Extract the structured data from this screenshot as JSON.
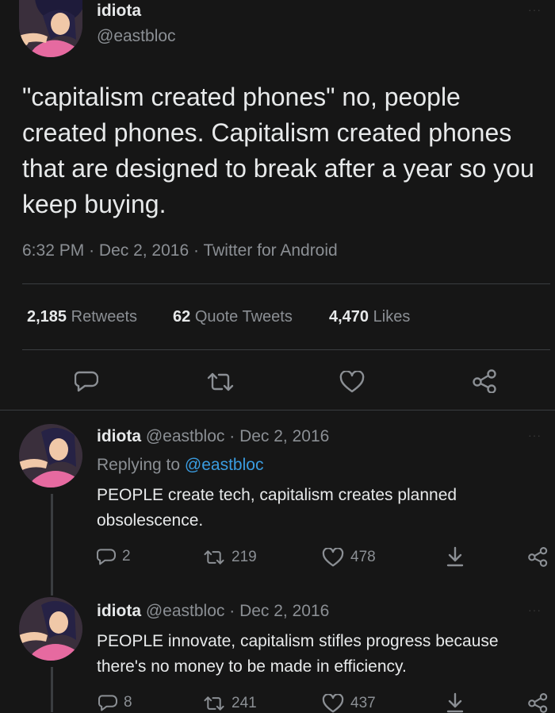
{
  "main_tweet": {
    "display_name": "idiota",
    "handle": "@eastbloc",
    "text": "\"capitalism created phones\" no, people created phones. Capitalism created phones that are designed to break after a year so you keep buying.",
    "time": "6:32 PM",
    "date": "Dec 2, 2016",
    "source": "Twitter for Android",
    "sep": "·",
    "stats": {
      "retweets_count": "2,185",
      "retweets_label": "Retweets",
      "quotes_count": "62",
      "quotes_label": "Quote Tweets",
      "likes_count": "4,470",
      "likes_label": "Likes"
    }
  },
  "replies": [
    {
      "display_name": "idiota",
      "handle": "@eastbloc",
      "sep": "·",
      "date": "Dec 2, 2016",
      "replying_label": "Replying to",
      "replying_to": "@eastbloc",
      "text": "PEOPLE create tech, capitalism creates planned obsolescence.",
      "replies": "2",
      "retweets": "219",
      "likes": "478"
    },
    {
      "display_name": "idiota",
      "handle": "@eastbloc",
      "sep": "·",
      "date": "Dec 2, 2016",
      "text": "PEOPLE innovate, capitalism stifles progress because there's no money to be made in efficiency.",
      "replies": "8",
      "retweets": "241",
      "likes": "437"
    }
  ],
  "icons": [
    "reply-icon",
    "retweet-icon",
    "like-icon",
    "share-icon",
    "download-icon",
    "more-icon"
  ],
  "colors": {
    "background": "#161616",
    "text": "#e7e9ea",
    "muted": "#8b8f94",
    "link": "#3a9ce0",
    "divider": "#3a3d40"
  }
}
